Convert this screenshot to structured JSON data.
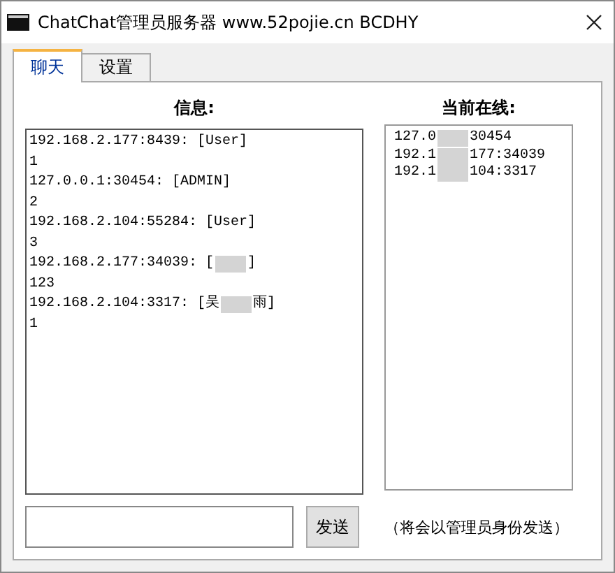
{
  "window": {
    "title": "ChatChat管理员服务器 www.52pojie.cn BCDHY"
  },
  "tabs": [
    {
      "label": "聊天",
      "selected": true
    },
    {
      "label": "设置",
      "selected": false
    }
  ],
  "messages": {
    "label": "信息:",
    "lines": [
      {
        "before": "192.168.2.177:8439: [User]"
      },
      {
        "before": "1"
      },
      {
        "before": "127.0.0.1:30454: [ADMIN]"
      },
      {
        "before": "2"
      },
      {
        "before": "192.168.2.104:55284: [User]"
      },
      {
        "before": "3"
      },
      {
        "before": "192.168.2.177:34039: [",
        "redacted": true,
        "after": "]"
      },
      {
        "before": "123"
      },
      {
        "before": "192.168.2.104:3317: [吴",
        "redacted": true,
        "after": "雨]"
      },
      {
        "before": "1"
      }
    ]
  },
  "online": {
    "label": "当前在线:",
    "lines": [
      {
        "before": "127.0",
        "redacted": true,
        "after": "30454"
      },
      {
        "before": "192.1",
        "redacted": true,
        "after": "177:34039"
      },
      {
        "before": "192.1",
        "redacted": true,
        "after": "104:3317"
      }
    ]
  },
  "send_button": "发送",
  "note": "（将会以管理员身份发送）"
}
